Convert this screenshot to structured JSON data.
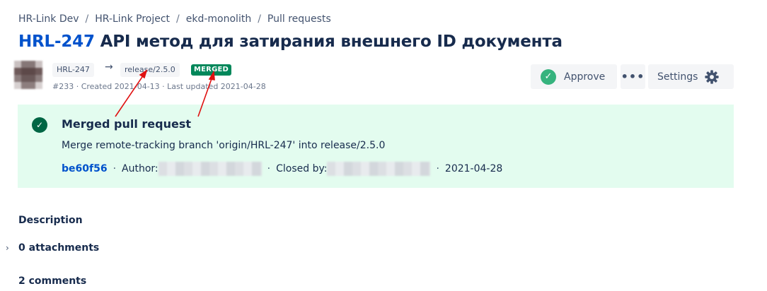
{
  "breadcrumb": {
    "items": [
      "HR-Link Dev",
      "HR-Link Project",
      "ekd-monolith",
      "Pull requests"
    ],
    "separator": "/"
  },
  "pr": {
    "key": "HRL-247",
    "title": "API метод для затирания внешнего ID документа",
    "source_branch": "HRL-247",
    "arrow": "→",
    "target_branch": "release/2.5.0",
    "status": "MERGED",
    "meta": "#233 · Created 2021-04-13 · Last updated 2021-04-28"
  },
  "actions": {
    "approve_label": "Approve",
    "more_label": "•••",
    "settings_label": "Settings"
  },
  "merged_panel": {
    "title": "Merged pull request",
    "message": "Merge remote-tracking branch 'origin/HRL-247' into release/2.5.0",
    "commit": "be60f56",
    "author_label": "Author:",
    "closed_by_label": "Closed by:",
    "date": "2021-04-28",
    "separator": "·"
  },
  "sections": {
    "description": "Description",
    "attachments": "0 attachments",
    "comments": "2 comments"
  },
  "colors": {
    "link_blue": "#0052cc",
    "merged_green": "#00875a",
    "panel_bg": "#e3fcef",
    "annotation_red": "#e01010"
  }
}
